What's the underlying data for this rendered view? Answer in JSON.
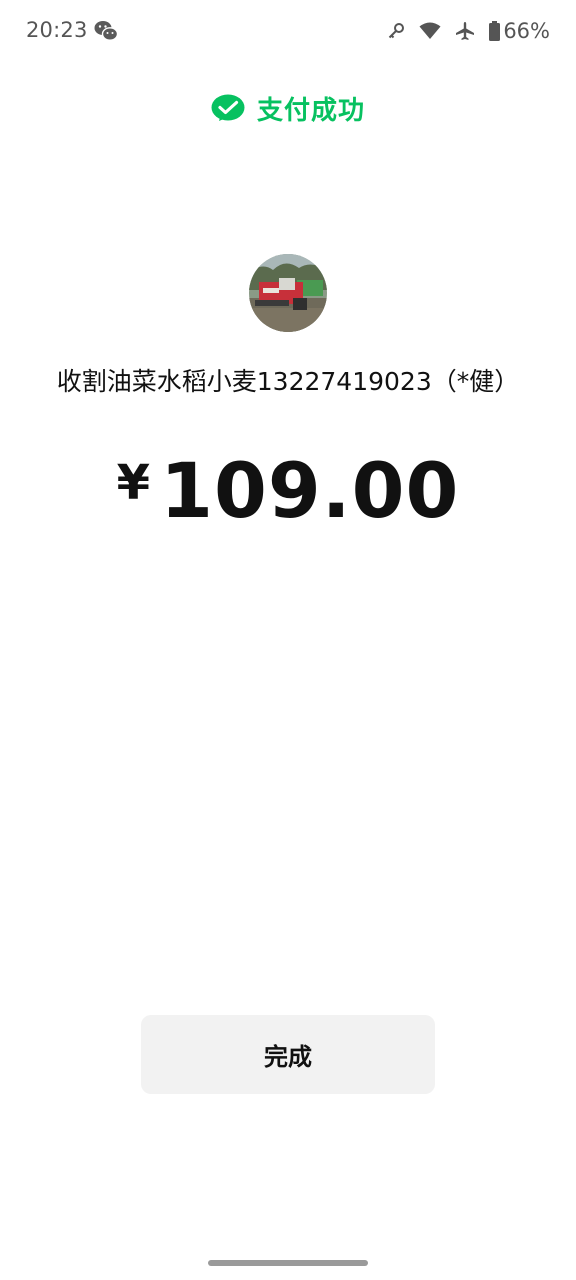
{
  "status_bar": {
    "time": "20:23",
    "battery_percent": "66%",
    "icons": [
      "wechat-icon",
      "key-icon",
      "wifi-icon",
      "airplane-icon",
      "battery-icon"
    ]
  },
  "payment": {
    "status_text": "支付成功",
    "merchant_name": "收割油菜水稻小麦13227419023（*健）",
    "currency_symbol": "¥",
    "amount": "109.00"
  },
  "actions": {
    "done_label": "完成"
  },
  "colors": {
    "accent": "#07c160",
    "text": "#111111",
    "button_bg": "#f2f2f2"
  }
}
